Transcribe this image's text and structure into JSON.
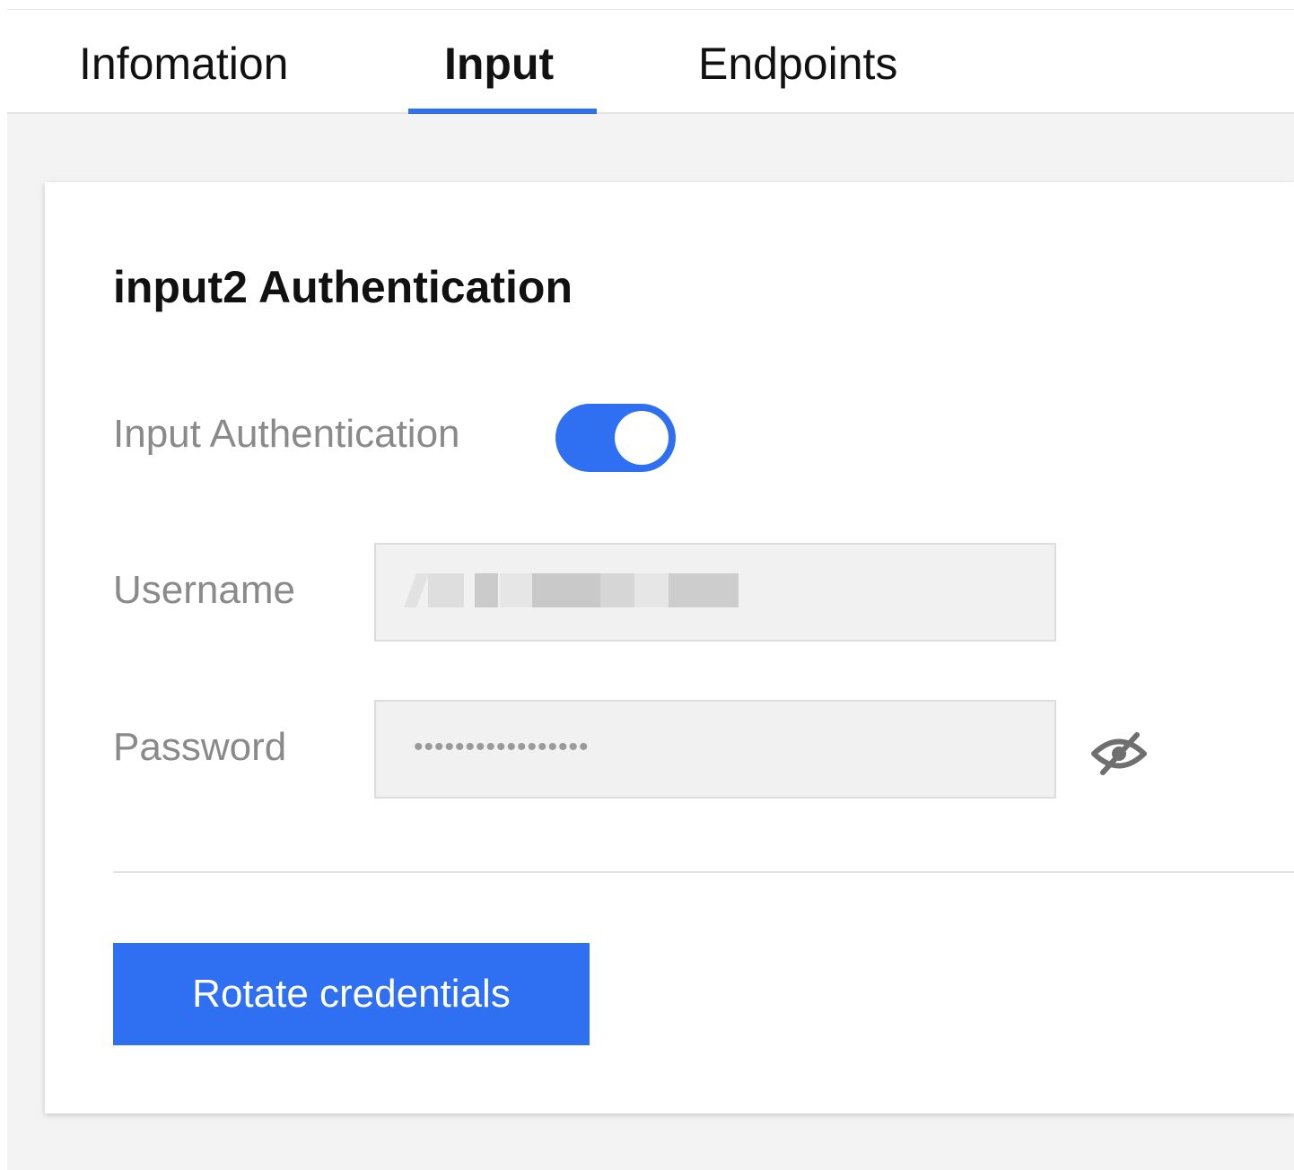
{
  "tabs": [
    {
      "label": "Infomation",
      "active": false
    },
    {
      "label": "Input",
      "active": true
    },
    {
      "label": "Endpoints",
      "active": false
    }
  ],
  "card": {
    "title": "input2 Authentication",
    "auth_toggle": {
      "label": "Input Authentication",
      "enabled": true
    },
    "username": {
      "label": "Username",
      "value_redacted": true
    },
    "password": {
      "label": "Password",
      "masked_value": "•••••••••••••••••",
      "visibility_icon": "eye-slash-icon"
    },
    "rotate_button_label": "Rotate credentials"
  },
  "colors": {
    "accent": "#2f6ff2",
    "page_bg": "#f3f3f3",
    "field_bg": "#f1f1f1",
    "label_gray": "#8a8a8a"
  }
}
